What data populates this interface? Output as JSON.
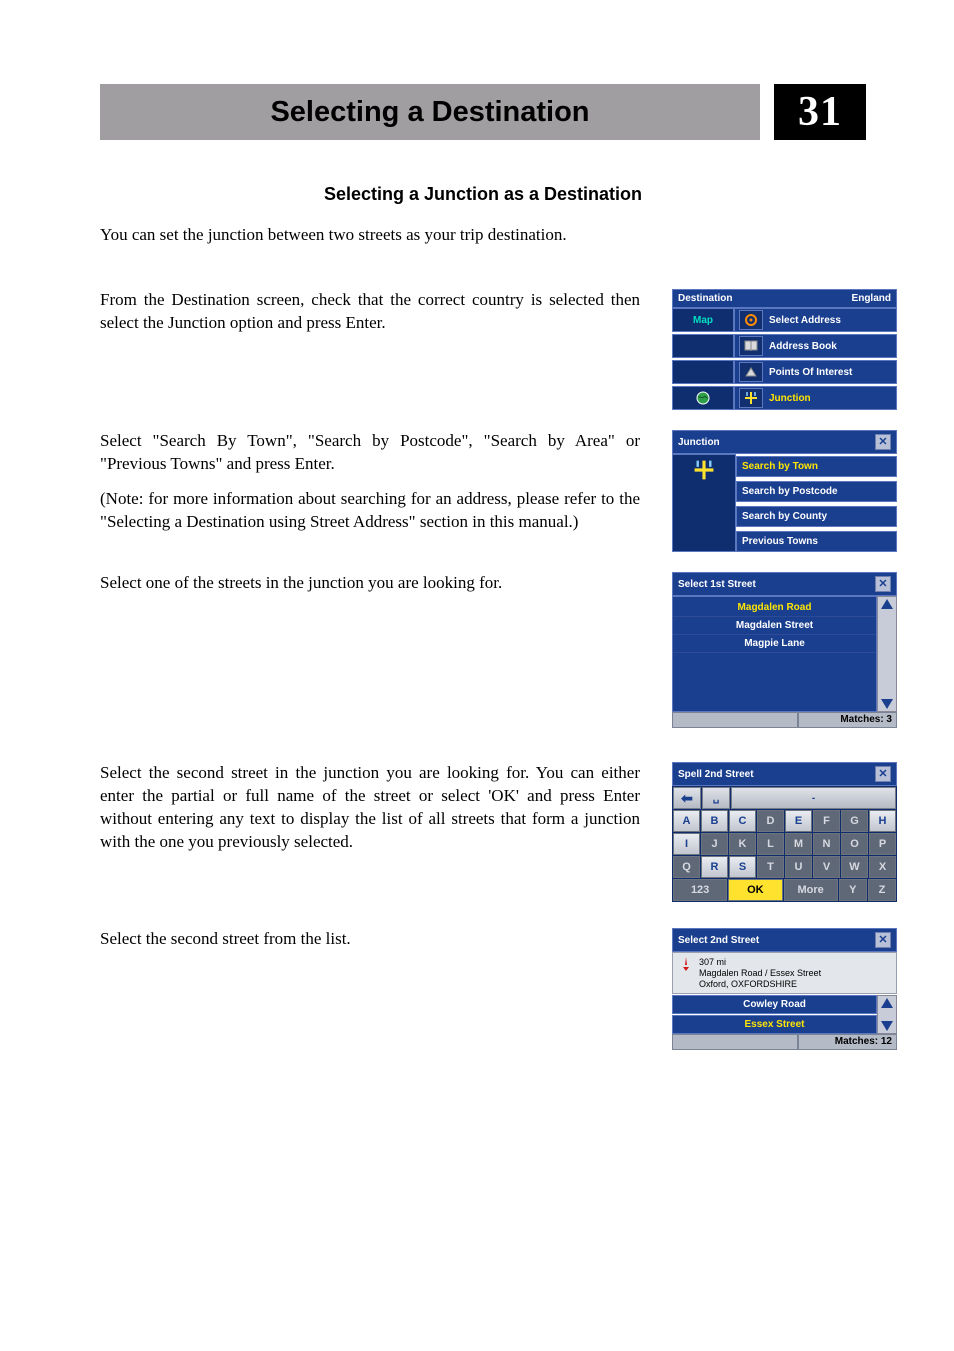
{
  "page": {
    "title": "Selecting a Destination",
    "number": "31",
    "subheading": "Selecting a Junction as a Destination",
    "intro": "You can set the junction between two streets as your trip destination."
  },
  "steps": {
    "s1": "From the Destination screen, check that the correct country is selected   then select the Junction option and press Enter.",
    "s2a": "Select \"Search By Town\", \"Search by Postcode\", \"Search by Area\" or \"Previous Towns\" and press Enter.",
    "s2b": "(Note: for more information about searching for an address, please refer to the \"Selecting a Destination using Street Address\" section in this manual.)",
    "s3": "Select one of the streets in the junction you are looking for.",
    "s4": "Select the second street in the junction you are looking for. You can either enter the partial or full name of the street or select 'OK' and press Enter without entering any text to display the list of all streets that form a junction with the one you previously selected.",
    "s5": "Select the second street from the list."
  },
  "dest": {
    "title": "Destination",
    "country": "England",
    "map": "Map",
    "items": [
      "Select Address",
      "Address Book",
      "Points Of Interest",
      "Junction"
    ]
  },
  "junction": {
    "title": "Junction",
    "items": [
      "Search by Town",
      "Search by Postcode",
      "Search by County",
      "Previous Towns"
    ]
  },
  "street1": {
    "title": "Select 1st Street",
    "items": [
      "Magdalen Road",
      "Magdalen Street",
      "Magpie Lane"
    ],
    "matches": "Matches:  3"
  },
  "kbd": {
    "title": "Spell 2nd Street",
    "row1": [
      "A",
      "B",
      "C",
      "D",
      "E",
      "F",
      "G",
      "H"
    ],
    "row2": [
      "I",
      "J",
      "K",
      "L",
      "M",
      "N",
      "O",
      "P"
    ],
    "row3": [
      "Q",
      "R",
      "S",
      "T",
      "U",
      "V",
      "W",
      "X"
    ],
    "row4": {
      "num": "123",
      "ok": "OK",
      "more": "More",
      "y": "Y",
      "z": "Z"
    },
    "active": [
      "A",
      "B",
      "C",
      "E",
      "H",
      "I",
      "R",
      "S"
    ]
  },
  "street2": {
    "title": "Select 2nd Street",
    "info_dist": "307 mi",
    "info_line1": "Magdalen Road / Essex Street",
    "info_line2": "Oxford, OXFORDSHIRE",
    "items": [
      "Cowley Road",
      "Essex Street"
    ],
    "matches": "Matches: 12"
  }
}
